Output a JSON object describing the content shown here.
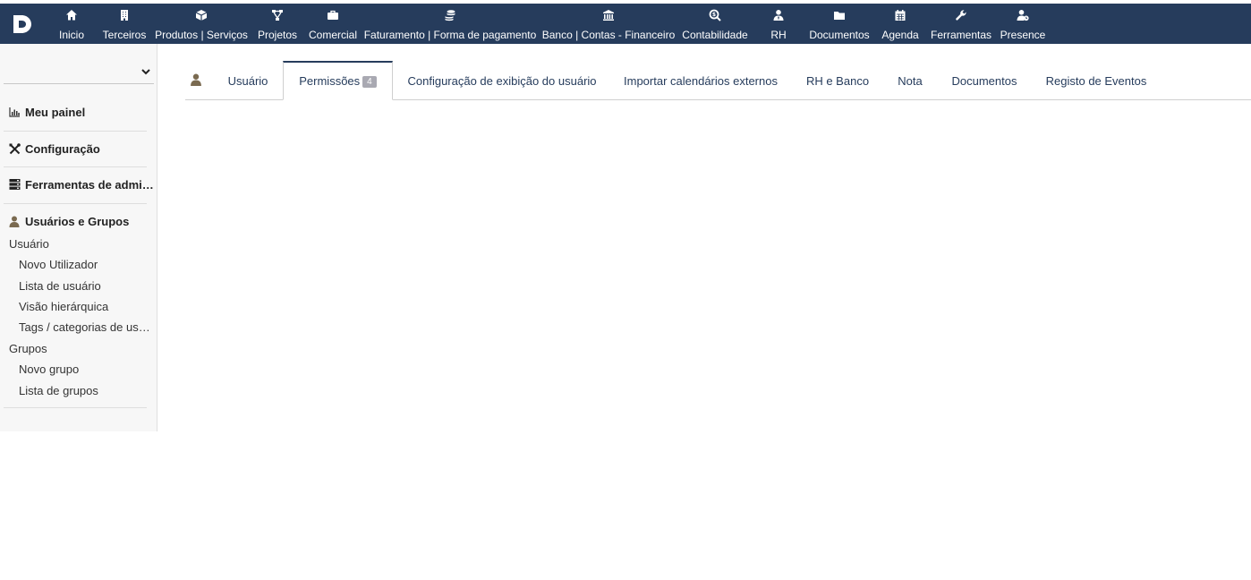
{
  "topnav": {
    "items": [
      {
        "label": "Inicio",
        "icon": "home-icon"
      },
      {
        "label": "Terceiros",
        "icon": "building-icon"
      },
      {
        "label": "Produtos | Serviços",
        "icon": "cube-icon"
      },
      {
        "label": "Projetos",
        "icon": "sitemap-icon"
      },
      {
        "label": "Comercial",
        "icon": "briefcase-icon"
      },
      {
        "label": "Faturamento | Forma de pagamento",
        "icon": "coins-icon"
      },
      {
        "label": "Banco | Contas - Financeiro",
        "icon": "bank-icon"
      },
      {
        "label": "Contabilidade",
        "icon": "search-dollar-icon"
      },
      {
        "label": "RH",
        "icon": "user-tie-icon"
      },
      {
        "label": "Documentos",
        "icon": "folder-icon"
      },
      {
        "label": "Agenda",
        "icon": "calendar-icon"
      },
      {
        "label": "Ferramentas",
        "icon": "wrench-icon"
      },
      {
        "label": "Presence",
        "icon": "user-clock-icon"
      }
    ],
    "active_index": 0
  },
  "sidebar": {
    "select_value": "",
    "sections": [
      {
        "label": "Meu painel",
        "icon": "chart-icon"
      },
      {
        "label": "Configuração",
        "icon": "tools-icon"
      },
      {
        "label": "Ferramentas de administração",
        "icon": "server-icon"
      },
      {
        "label": "Usuários e Grupos",
        "icon": "user-icon"
      }
    ],
    "groups": [
      {
        "label": "Usuário",
        "links": [
          "Novo Utilizador",
          "Lista de usuário",
          "Visão hierárquica",
          "Tags / categorias de usuários"
        ]
      },
      {
        "label": "Grupos",
        "links": [
          "Novo grupo",
          "Lista de grupos"
        ]
      }
    ]
  },
  "tabs": {
    "items": [
      {
        "label": "Usuário"
      },
      {
        "label": "Permissões",
        "badge": "4"
      },
      {
        "label": "Configuração de exibição do usuário"
      },
      {
        "label": "Importar calendários externos"
      },
      {
        "label": "RH e Banco"
      },
      {
        "label": "Nota"
      },
      {
        "label": "Documentos"
      },
      {
        "label": "Registo de Eventos"
      }
    ],
    "active_index": 1
  },
  "colors": {
    "navbar": "#263c5c",
    "accent": "#263c5c",
    "badge": "#a9a9b2",
    "user_icon": "#7a6a50"
  }
}
